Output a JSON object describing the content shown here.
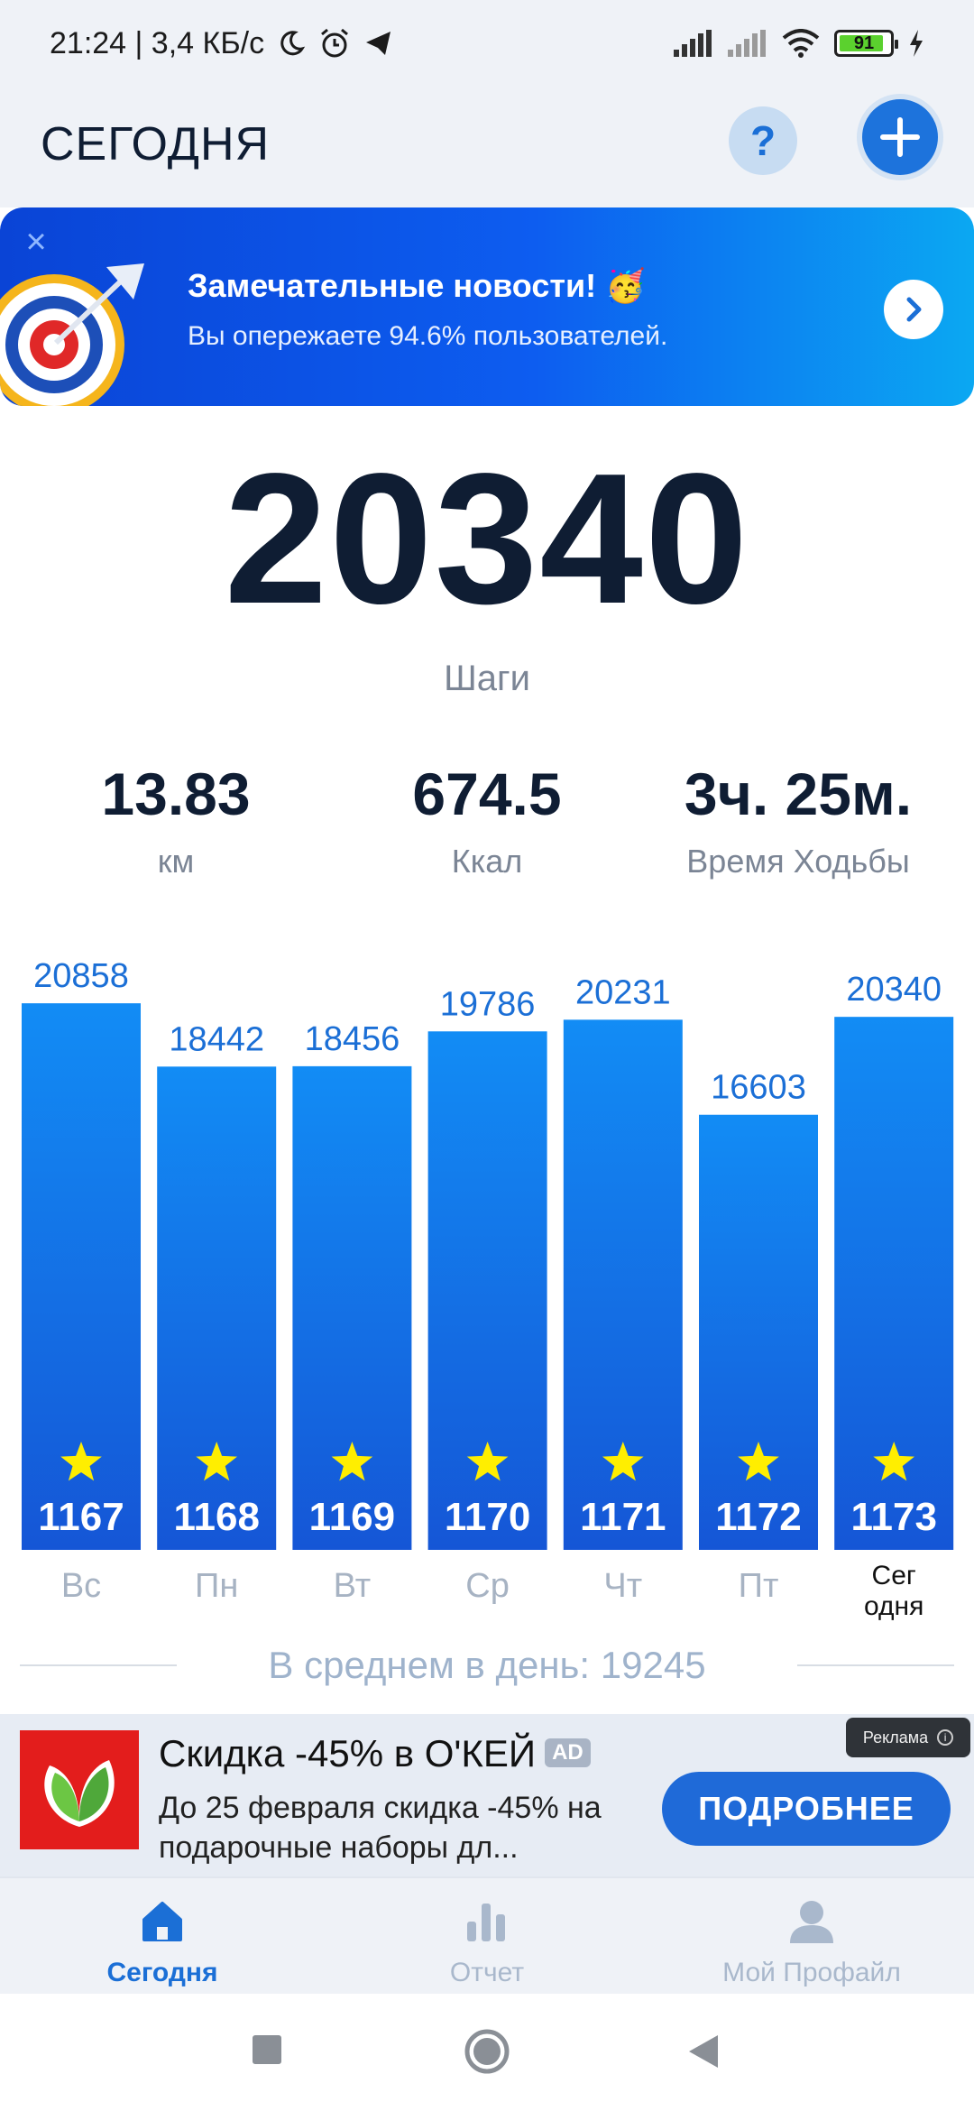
{
  "status_bar": {
    "time_speed": "21:24 | 3,4 КБ/с",
    "battery": "91"
  },
  "header": {
    "title": "СЕГОДНЯ",
    "help_label": "?"
  },
  "banner": {
    "title": "Замечательные новости! 🥳",
    "subtitle": "Вы опережаете 94.6% пользователей."
  },
  "steps": {
    "value": "20340",
    "label": "Шаги"
  },
  "stats": [
    {
      "value": "13.83",
      "label": "км"
    },
    {
      "value": "674.5",
      "label": "Ккал"
    },
    {
      "value": "3ч. 25м.",
      "label": "Время Ходьбы"
    }
  ],
  "chart_data": {
    "type": "bar",
    "categories": [
      "Вс",
      "Пн",
      "Вт",
      "Ср",
      "Чт",
      "Пт",
      "Сег\nодня"
    ],
    "values": [
      20858,
      18442,
      18456,
      19786,
      20231,
      16603,
      20340
    ],
    "inner_labels": [
      "1167",
      "1168",
      "1169",
      "1170",
      "1171",
      "1172",
      "1173"
    ],
    "active_index": 6,
    "bar_color_top": "#128cf5",
    "bar_color_bottom": "#1556d6",
    "star_color": "#ffee00"
  },
  "average": {
    "text": "В среднем в день: 19245"
  },
  "ad": {
    "title": "Скидка -45% в О'КЕЙ",
    "badge": "AD",
    "text": "До 25 февраля скидка -45% на подарочные наборы дл...",
    "button": "ПОДРОБНЕЕ",
    "label": "Реклама"
  },
  "bottom_nav": [
    {
      "label": "Сегодня",
      "icon": "home-icon",
      "active": true
    },
    {
      "label": "Отчет",
      "icon": "bar-chart-icon",
      "active": false
    },
    {
      "label": "Мой Профайл",
      "icon": "person-icon",
      "active": false
    }
  ],
  "colors": {
    "accent": "#1b6fd6",
    "title": "#0f1d33",
    "muted": "#7b8595"
  }
}
